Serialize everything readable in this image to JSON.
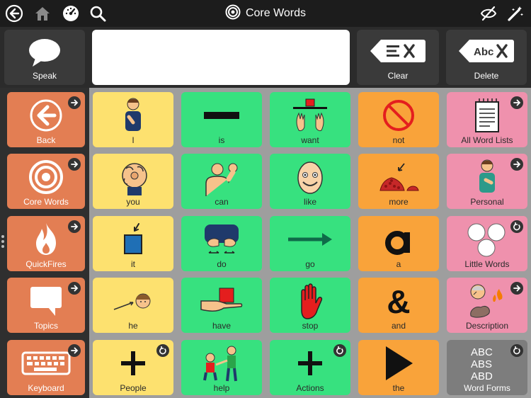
{
  "topbar": {
    "title": "Core Words",
    "icons": [
      "back-circle-icon",
      "home-icon",
      "speedometer-icon",
      "search-icon",
      "hide-icon",
      "edit-wand-icon"
    ]
  },
  "speak_row": {
    "speak_label": "Speak",
    "message_text": "",
    "clear_label": "Clear",
    "delete_label": "Delete"
  },
  "nav": [
    {
      "label": "Back",
      "icon": "back-arrow-icon"
    },
    {
      "label": "Core Words",
      "icon": "target-icon"
    },
    {
      "label": "QuickFires",
      "icon": "flame-icon"
    },
    {
      "label": "Topics",
      "icon": "speech-bubble-icon"
    },
    {
      "label": "Keyboard",
      "icon": "keyboard-icon"
    }
  ],
  "grid": {
    "col1": [
      "I",
      "you",
      "it",
      "he",
      "People"
    ],
    "col2": [
      "is",
      "can",
      "do",
      "have",
      "help"
    ],
    "col3": [
      "want",
      "like",
      "go",
      "stop",
      "Actions"
    ],
    "col4": [
      "not",
      "more",
      "a",
      "and",
      "the"
    ],
    "col5": [
      "All Word Lists",
      "Personal",
      "Little Words",
      "Description",
      "Word Forms"
    ]
  },
  "colors": {
    "yellow": "#fde16f",
    "green": "#37e17f",
    "orange": "#f9a33a",
    "pink": "#ef91ad",
    "nav": "#e37e53",
    "gray": "#7d7d7d"
  }
}
